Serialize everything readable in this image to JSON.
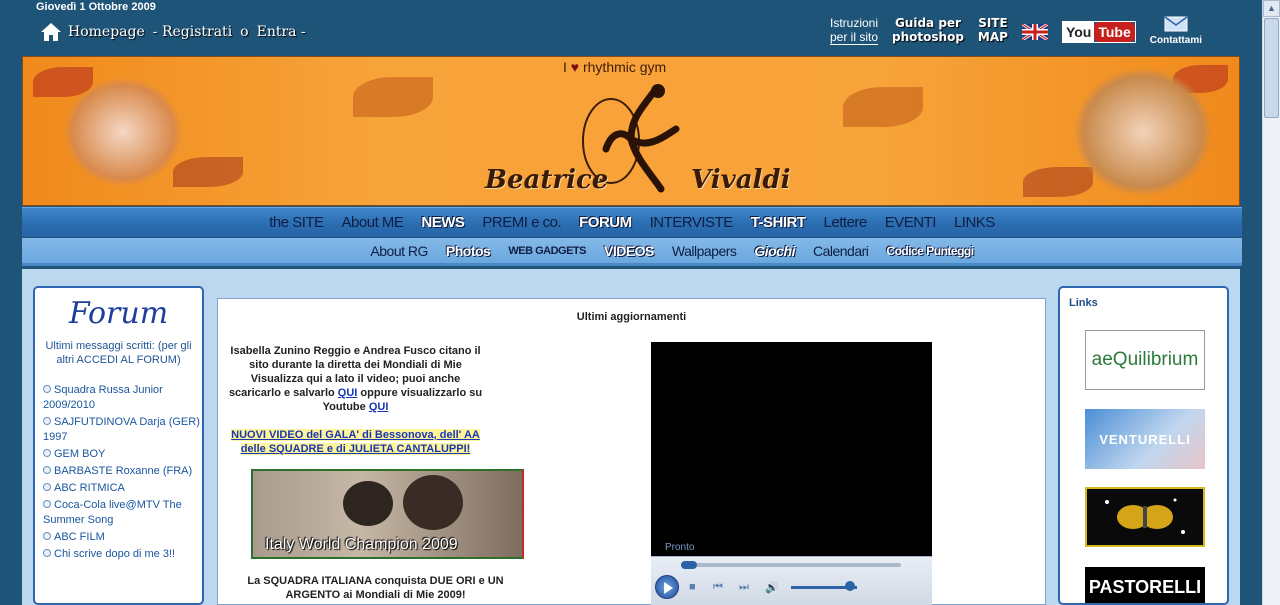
{
  "date": "Giovedì 1 Ottobre 2009",
  "top_nav": {
    "home": "Homepage",
    "register": "- Registrati",
    "or": "o",
    "login": "Entra -"
  },
  "top_right": {
    "instructions_line1": "Istruzioni",
    "instructions_line2": "per il sito",
    "guide_line1": "Guida per",
    "guide_line2": "photoshop",
    "sitemap_line1": "SITE",
    "sitemap_line2": "MAP",
    "youtube_you": "You",
    "youtube_tube": "Tube",
    "contact": "Contattami"
  },
  "banner": {
    "tagline_pre": "I",
    "tagline_post": "rhythmic gym",
    "name_first": "Beatrice",
    "name_last": "Vivaldi"
  },
  "menu_main": [
    "the SITE",
    "About ME",
    "NEWS",
    "PREMI e co.",
    "FORUM",
    "INTERVISTE",
    "T-SHIRT",
    "Lettere",
    "EVENTI",
    "LINKS"
  ],
  "menu_sub": [
    "About RG",
    "Photos",
    "WEB GADGETS",
    "VIDEOS",
    "Wallpapers",
    "Giochi",
    "Calendari",
    "Codice Punteggi"
  ],
  "forum": {
    "title": "Forum",
    "subtitle": "Ultimi messaggi scritti: (per gli altri ACCEDI AL FORUM)",
    "items": [
      "Squadra Russa Junior 2009/2010",
      "SAJFUTDINOVA Darja (GER) 1997",
      "GEM BOY",
      "BARBASTE Roxanne (FRA)",
      "ABC RITMICA",
      "Coca-Cola live@MTV The Summer Song",
      "ABC FILM",
      "Chi scrive dopo di me 3!!"
    ]
  },
  "center": {
    "title": "Ultimi aggiornamenti",
    "para1_a": "Isabella Zunino Reggio e Andrea Fusco citano il sito durante la diretta dei Mondiali di Mie Visualizza qui a lato il video; puoi anche scaricarlo e salvarlo",
    "qui1": "QUI",
    "para1_b": "oppure visualizzarlo su Youtube",
    "qui2": "QUI",
    "news_link": "NUOVI VIDEO del GALA' di Bessonova, dell' AA delle SQUADRE e di JULIETA CANTALUPPI!",
    "image_caption": "Italy World Champion 2009",
    "para2": "La SQUADRA ITALIANA conquista DUE ORI e UN ARGENTO ai Mondiali di Mie 2009!",
    "player_status": "Pronto"
  },
  "links": {
    "title": "Links",
    "banner1": "aeQuilibrium",
    "banner2": "VENTURELLI",
    "banner4": "PASTORELLI"
  }
}
